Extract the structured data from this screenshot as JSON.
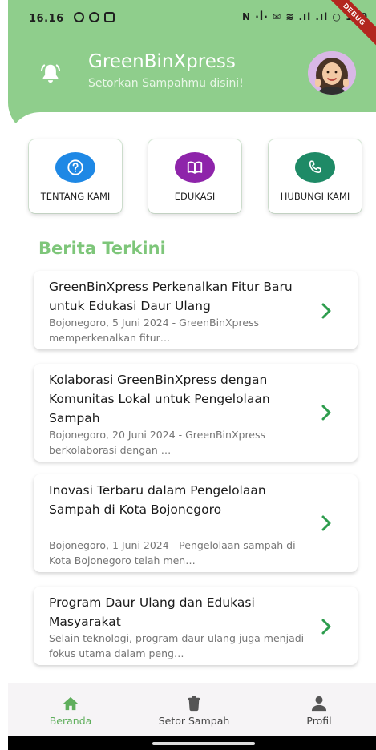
{
  "status_bar": {
    "time": "16.16",
    "right_text": "N ·ꟾ· ✉ ≋ .ıl .ıl ○ 100",
    "debug_label": "DEBUG"
  },
  "header": {
    "title": "GreenBinXpress",
    "subtitle": "Setorkan Sampahmu disini!"
  },
  "menu": [
    {
      "label": "TENTANG KAMI",
      "icon": "question-icon",
      "color": "#1e88e5"
    },
    {
      "label": "EDUKASI",
      "icon": "book-icon",
      "color": "#8e24aa"
    },
    {
      "label": "HUBUNGI KAMI",
      "icon": "phone-icon",
      "color": "#1e8a66"
    }
  ],
  "news": {
    "section_title": "Berita Terkini",
    "items": [
      {
        "title": "GreenBinXpress Perkenalkan Fitur Baru untuk Edukasi Daur Ulang",
        "snippet": "Bojonegoro, 5 Juni 2024 - GreenBinXpress memperkenalkan fitur…"
      },
      {
        "title": "Kolaborasi GreenBinXpress dengan Komunitas Lokal untuk Pengelolaan Sampah",
        "snippet": "Bojonegoro, 20 Juni 2024 - GreenBinXpress berkolaborasi dengan …"
      },
      {
        "title": "Inovasi Terbaru dalam Pengelolaan Sampah di Kota Bojonegoro",
        "snippet": "Bojonegoro, 1 Juni 2024 - Pengelolaan sampah di Kota Bojonegoro telah men…"
      },
      {
        "title": "Program Daur Ulang dan Edukasi Masyarakat",
        "snippet": "Selain teknologi, program daur ulang juga menjadi fokus utama dalam peng…"
      }
    ]
  },
  "bottom_nav": [
    {
      "label": "Beranda",
      "icon": "home-icon",
      "active": true
    },
    {
      "label": "Setor Sampah",
      "icon": "trash-icon",
      "active": false
    },
    {
      "label": "Profil",
      "icon": "person-icon",
      "active": false
    }
  ],
  "colors": {
    "brand_green": "#8fce8c",
    "title_green": "#7ec67a",
    "chevron_green": "#2e9d4e",
    "nav_active": "#5fae5c",
    "nav_inactive": "#555555"
  }
}
